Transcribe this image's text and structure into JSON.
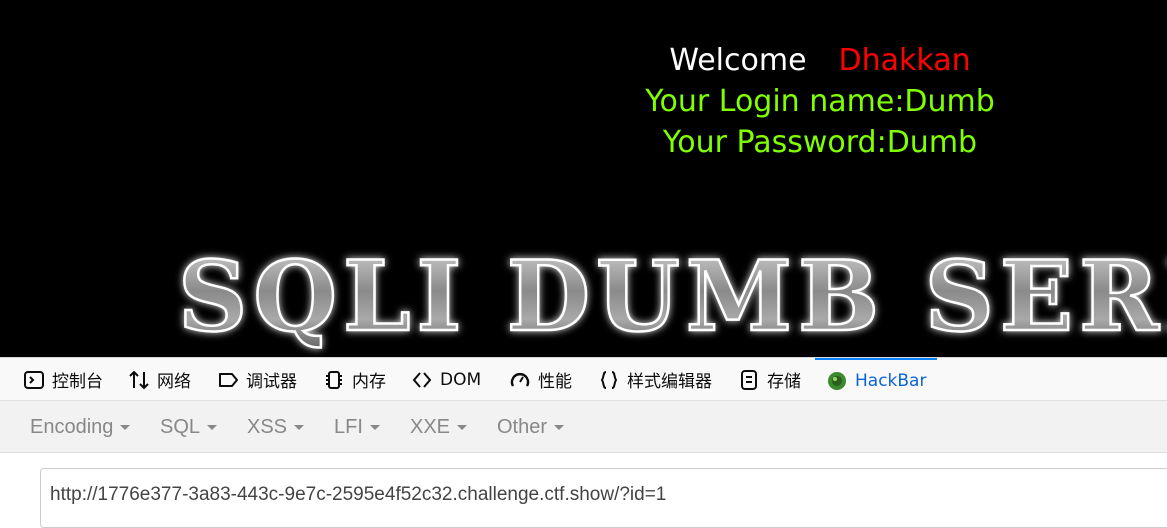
{
  "page": {
    "welcome_word": "Welcome",
    "welcome_name": "Dhakkan",
    "login_line": "Your Login name:Dumb",
    "password_line": "Your Password:Dumb",
    "banner_text": "SQLI DUMB SERI",
    "colors": {
      "background": "#000000",
      "welcome": "#ffffff",
      "name": "#ff0000",
      "info": "#7fff00"
    }
  },
  "devtools": {
    "tabs": [
      {
        "label": "控制台",
        "icon": "console-icon"
      },
      {
        "label": "网络",
        "icon": "network-arrows-icon"
      },
      {
        "label": "调试器",
        "icon": "debugger-icon"
      },
      {
        "label": "内存",
        "icon": "memory-chip-icon"
      },
      {
        "label": "DOM",
        "icon": "dom-brackets-icon"
      },
      {
        "label": "性能",
        "icon": "performance-gauge-icon"
      },
      {
        "label": "样式编辑器",
        "icon": "style-braces-icon"
      },
      {
        "label": "存储",
        "icon": "storage-icon"
      },
      {
        "label": "HackBar",
        "icon": "hackbar-logo-icon",
        "active": true
      }
    ],
    "active_color": "#0a84ff"
  },
  "hackbar": {
    "menus": [
      "Encoding",
      "SQL",
      "XSS",
      "LFI",
      "XXE",
      "Other"
    ],
    "url": "http://1776e377-3a83-443c-9e7c-2595e4f52c32.challenge.ctf.show/?id=1"
  }
}
